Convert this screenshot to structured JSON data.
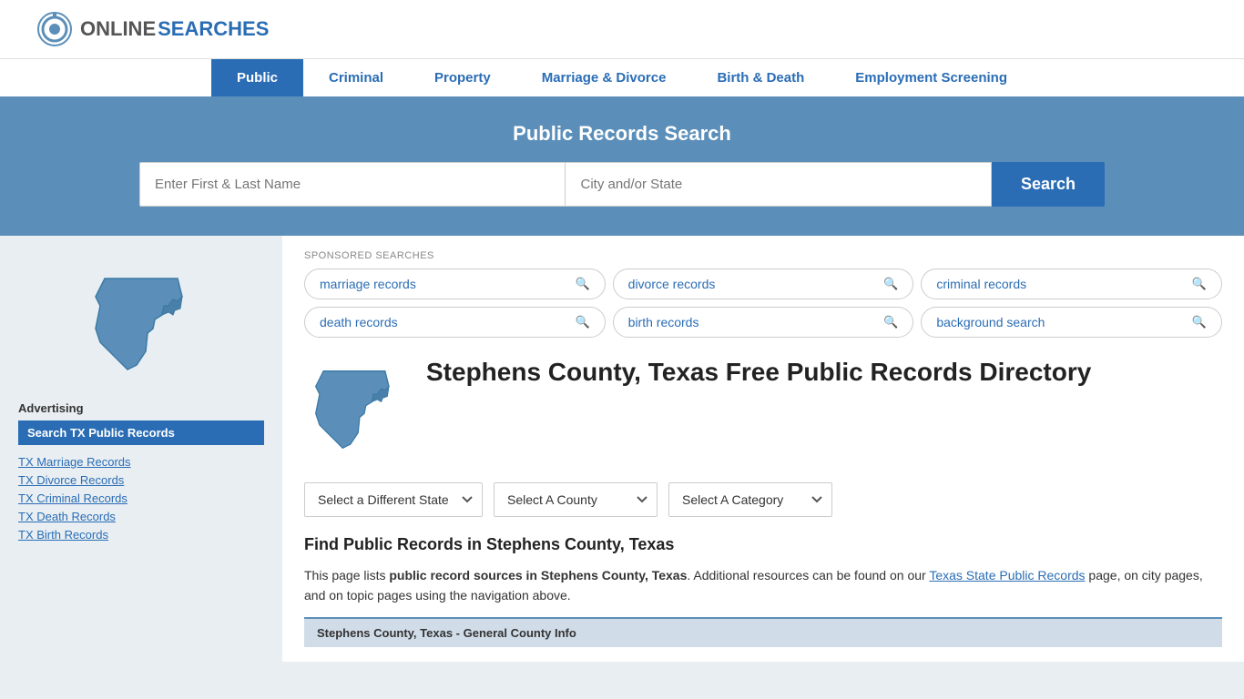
{
  "site": {
    "logo_online": "ONLINE",
    "logo_searches": "SEARCHES"
  },
  "nav": {
    "items": [
      {
        "label": "Public",
        "active": true
      },
      {
        "label": "Criminal",
        "active": false
      },
      {
        "label": "Property",
        "active": false
      },
      {
        "label": "Marriage & Divorce",
        "active": false
      },
      {
        "label": "Birth & Death",
        "active": false
      },
      {
        "label": "Employment Screening",
        "active": false
      }
    ]
  },
  "hero": {
    "title": "Public Records Search",
    "name_placeholder": "Enter First & Last Name",
    "city_placeholder": "City and/or State",
    "search_btn": "Search"
  },
  "sponsored": {
    "label": "SPONSORED SEARCHES",
    "items": [
      {
        "text": "marriage records"
      },
      {
        "text": "divorce records"
      },
      {
        "text": "criminal records"
      },
      {
        "text": "death records"
      },
      {
        "text": "birth records"
      },
      {
        "text": "background search"
      }
    ]
  },
  "page": {
    "title": "Stephens County, Texas Free Public Records Directory"
  },
  "dropdowns": {
    "state_label": "Select a Different State",
    "county_label": "Select A County",
    "category_label": "Select A Category"
  },
  "find_section": {
    "title": "Find Public Records in Stephens County, Texas",
    "description_start": "This page lists ",
    "bold_text": "public record sources in Stephens County, Texas",
    "description_middle": ". Additional resources can be found on our ",
    "link_text": "Texas State Public Records",
    "description_end": " page, on city pages, and on topic pages using the navigation above."
  },
  "general_info": {
    "label": "Stephens County, Texas - General County Info"
  },
  "sidebar": {
    "advertising_label": "Advertising",
    "ad_button": "Search TX Public Records",
    "links": [
      {
        "text": "TX Marriage Records"
      },
      {
        "text": "TX Divorce Records"
      },
      {
        "text": "TX Criminal Records"
      },
      {
        "text": "TX Death Records"
      },
      {
        "text": "TX Birth Records"
      }
    ]
  }
}
